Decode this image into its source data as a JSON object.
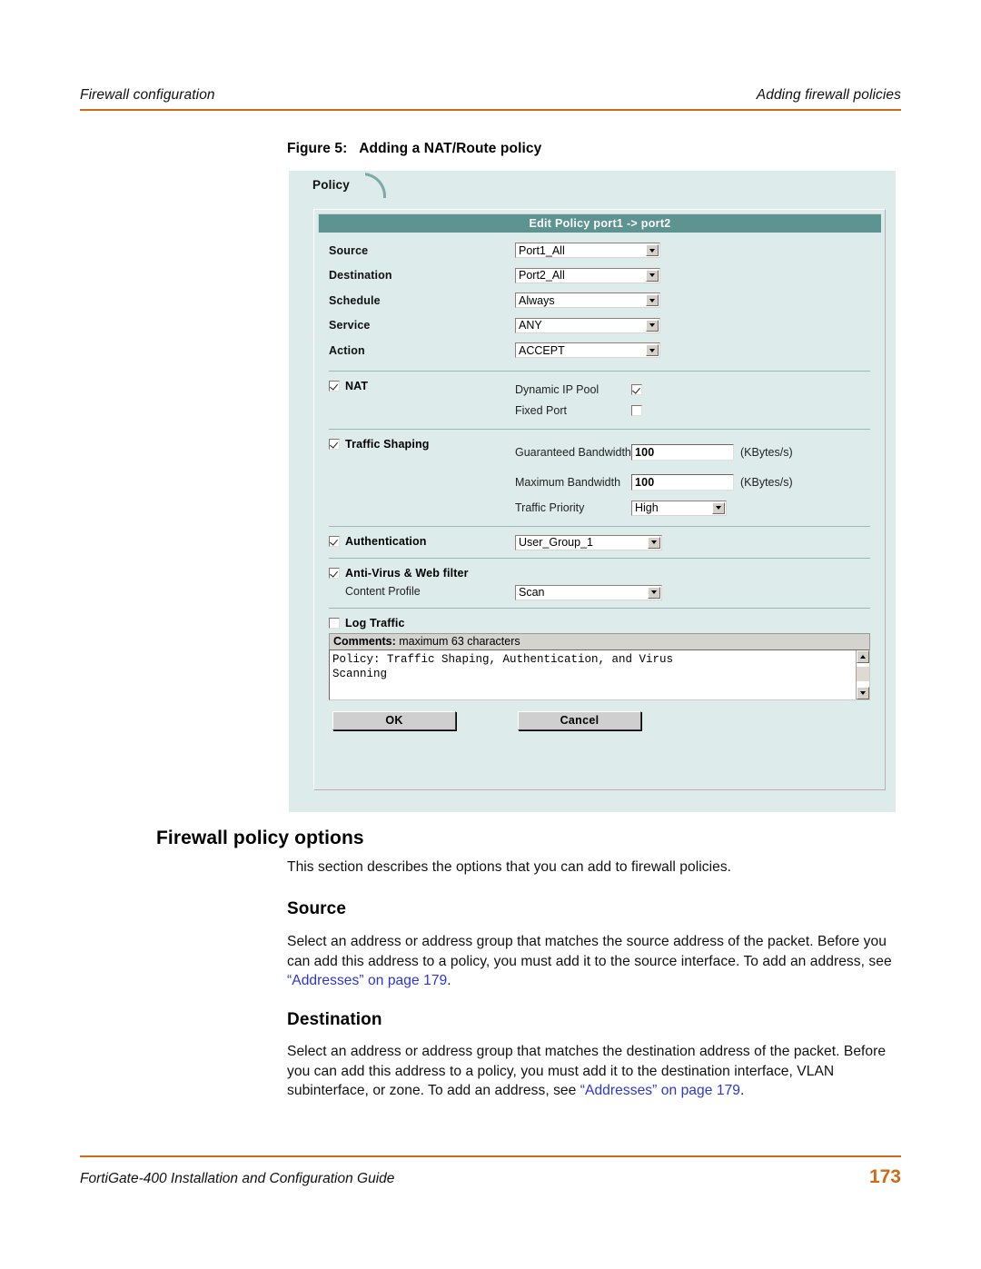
{
  "header": {
    "left": "Firewall configuration",
    "right": "Adding firewall policies",
    "rule_color": "#cf6a16"
  },
  "figure": {
    "label": "Figure 5:",
    "caption": "Adding a NAT/Route policy"
  },
  "gui": {
    "tab_label": "Policy",
    "panel_bg": "#ddeceb",
    "titlebar_bg": "#5d9391",
    "title": "Edit Policy port1 -> port2",
    "fields": [
      {
        "label": "Source",
        "value": "Port1_All"
      },
      {
        "label": "Destination",
        "value": "Port2_All"
      },
      {
        "label": "Schedule",
        "value": "Always"
      },
      {
        "label": "Service",
        "value": "ANY"
      },
      {
        "label": "Action",
        "value": "ACCEPT"
      }
    ],
    "nat": {
      "label": "NAT",
      "checked": true,
      "dynamic_ip_pool_label": "Dynamic IP Pool",
      "dynamic_ip_pool_checked": true,
      "fixed_port_label": "Fixed Port",
      "fixed_port_checked": false
    },
    "traffic_shaping": {
      "label": "Traffic Shaping",
      "checked": true,
      "guaranteed_label": "Guaranteed Bandwidth",
      "guaranteed_value": "100",
      "guaranteed_units": "(KBytes/s)",
      "maximum_label": "Maximum Bandwidth",
      "maximum_value": "100",
      "maximum_units": "(KBytes/s)",
      "priority_label": "Traffic Priority",
      "priority_value": "High"
    },
    "authentication": {
      "label": "Authentication",
      "checked": true,
      "value": "User_Group_1"
    },
    "antivirus": {
      "label": "Anti-Virus & Web filter",
      "checked": true,
      "content_profile_label": "Content Profile",
      "content_profile_value": "Scan"
    },
    "log_traffic": {
      "label": "Log Traffic",
      "checked": false
    },
    "comments": {
      "head_bold": "Comments:",
      "head_rest": " maximum 63 characters",
      "value": "Policy: Traffic Shaping, Authentication, and Virus\nScanning"
    },
    "buttons": {
      "ok": "OK",
      "cancel": "Cancel"
    }
  },
  "content": {
    "h1": "Firewall policy options",
    "intro": "This section describes the options that you can add to firewall policies.",
    "source": {
      "heading": "Source",
      "text_a": "Select an address or address group that matches the source address of the packet. Before you can add this address to a policy, you must add it to the source interface. To add an address, see ",
      "link": "“Addresses” on page 179",
      "text_b": "."
    },
    "destination": {
      "heading": "Destination",
      "text_a": "Select an address or address group that matches the destination address of the packet. Before you can add this address to a policy, you must add it to the destination interface, VLAN subinterface, or zone. To add an address, see ",
      "link": "“Addresses” on page 179",
      "text_b": "."
    },
    "link_color": "#2b35d8"
  },
  "footer": {
    "guide": "FortiGate-400 Installation and Configuration Guide",
    "page_number": "173"
  }
}
